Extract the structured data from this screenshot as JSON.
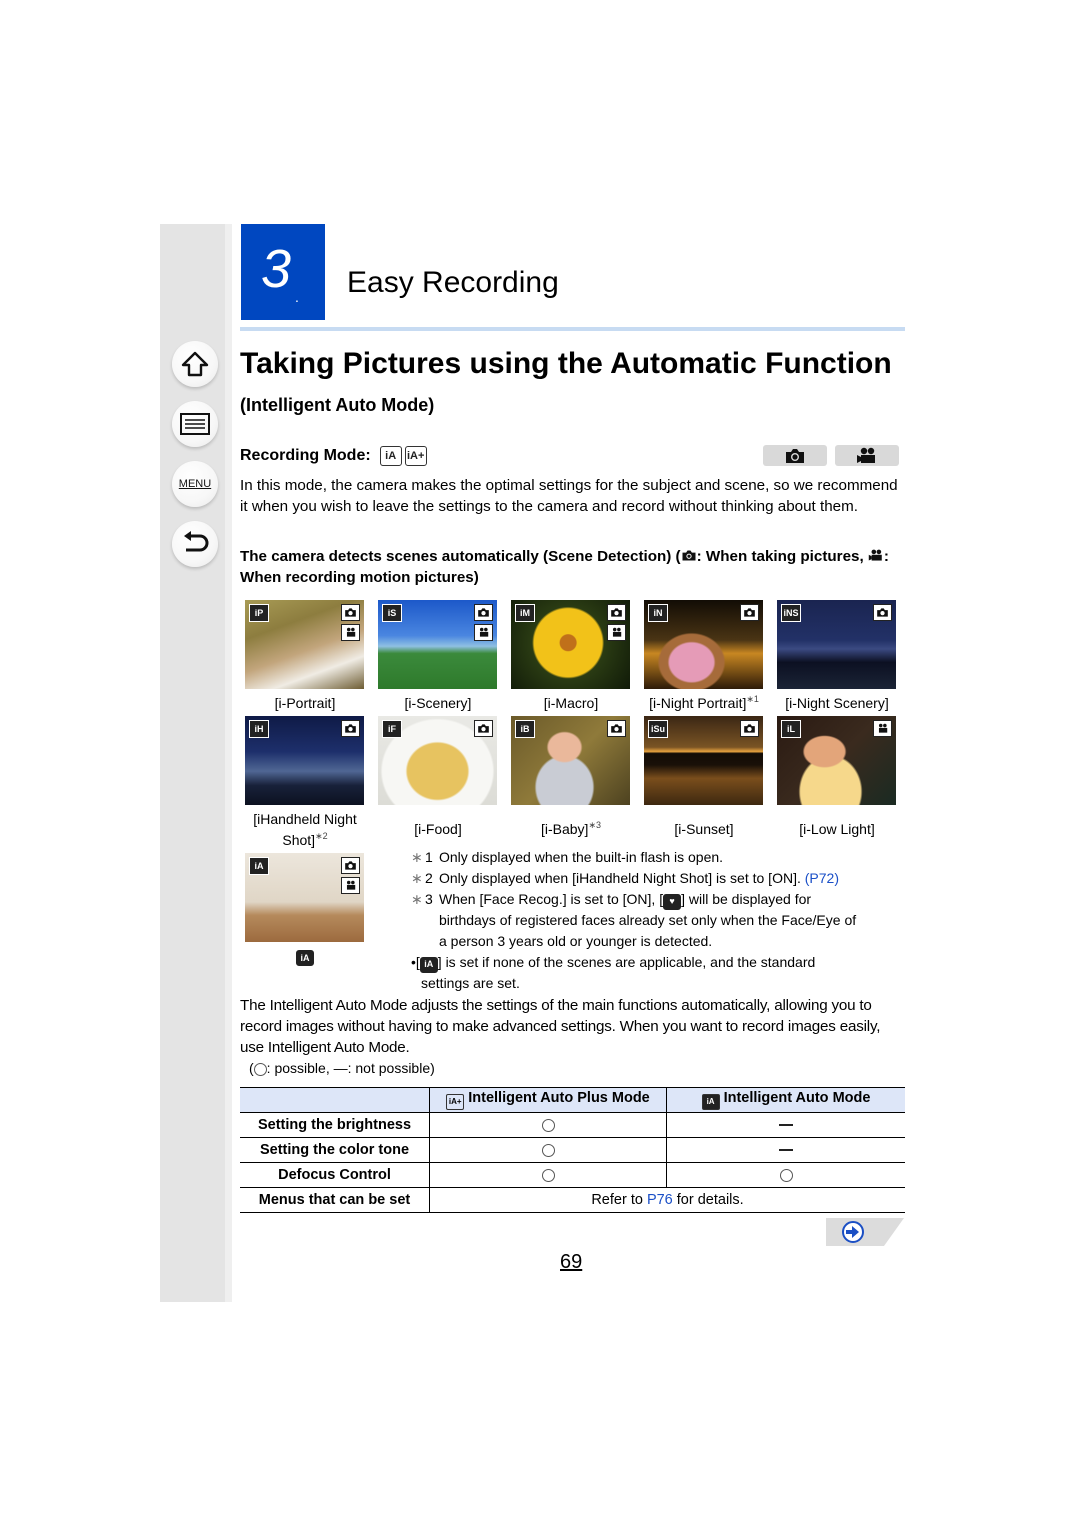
{
  "sidebar": {
    "items": [
      {
        "name": "home",
        "icon": "home-icon"
      },
      {
        "name": "contents",
        "icon": "list-icon"
      },
      {
        "name": "menu",
        "icon": "menu-icon",
        "label": "MENU"
      },
      {
        "name": "back",
        "icon": "back-arrow-icon"
      }
    ]
  },
  "chapter": {
    "number": "3",
    "dot": ".",
    "title": "Easy Recording",
    "accent_color": "#0047c0"
  },
  "page": {
    "title": "Taking Pictures using the Automatic Function",
    "subtitle": "(Intelligent Auto Mode)",
    "recording_mode_label": "Recording Mode:",
    "recording_mode_icons": [
      "iA",
      "iA+"
    ],
    "mode_tabs": [
      {
        "icon": "camera-icon"
      },
      {
        "icon": "movie-camera-icon"
      }
    ],
    "intro": "In this mode, the camera makes the optimal settings for the subject and scene, so we recommend it when you wish to leave the settings to the camera and record without thinking about them.",
    "detect_part1": "The camera detects scenes automatically (Scene Detection) (",
    "detect_part2": ": When taking pictures, ",
    "detect_part3": ": When recording motion pictures)",
    "page_number": "69"
  },
  "scenes": [
    {
      "caption": "[i-Portrait]",
      "note": "",
      "icon": "iP",
      "photo": true,
      "movie": true
    },
    {
      "caption": "[i-Scenery]",
      "note": "",
      "icon": "iS",
      "photo": true,
      "movie": true
    },
    {
      "caption": "[i-Macro]",
      "note": "",
      "icon": "iM",
      "photo": true,
      "movie": true
    },
    {
      "caption": "[i-Night Portrait]",
      "note": "∗1",
      "icon": "iN",
      "photo": true,
      "movie": false
    },
    {
      "caption": "[i-Night Scenery]",
      "note": "",
      "icon": "iNS",
      "photo": true,
      "movie": false
    },
    {
      "caption": "[iHandheld Night",
      "caption2": "Shot]",
      "note": "∗2",
      "icon": "iH",
      "photo": true,
      "movie": false
    },
    {
      "caption": "[i-Food]",
      "note": "",
      "icon": "iF",
      "photo": true,
      "movie": false
    },
    {
      "caption": "[i-Baby]",
      "note": "∗3",
      "icon": "iB",
      "photo": true,
      "movie": false
    },
    {
      "caption": "[i-Sunset]",
      "note": "",
      "icon": "iSu",
      "photo": true,
      "movie": false
    },
    {
      "caption": "[i-Low Light]",
      "note": "",
      "icon": "iL",
      "photo": false,
      "movie": true
    },
    {
      "caption": "",
      "note": "",
      "icon": "iA",
      "photo": true,
      "movie": true,
      "below_icon": "iA"
    }
  ],
  "notes": [
    {
      "mark": "∗",
      "num": "1",
      "text": "Only displayed when the built-in flash is open."
    },
    {
      "mark": "∗",
      "num": "2",
      "text": "Only displayed when [iHandheld Night Shot] is set to [ON]. ",
      "link": "(P72)"
    },
    {
      "mark": "∗",
      "num": "3",
      "text_a": "When [Face Recog.] is set to [ON], [",
      "text_b": "] will be displayed for",
      "text_c": "birthdays of registered faces already set only when the Face/Eye of",
      "text_d": "a person 3 years old or younger is detected."
    },
    {
      "bullet": "•",
      "text_a": "[",
      "text_b": "] is set if none of the scenes are applicable, and the standard",
      "text_c": "settings are set."
    }
  ],
  "summary": "The Intelligent Auto Mode adjusts the settings of the main functions automatically, allowing you to record images without having to make advanced settings. When you want to record images easily, use Intelligent Auto Mode.",
  "legend": {
    "open": "(",
    "possible": ": possible, ",
    "dash": "—",
    "not_possible": ": not possible)"
  },
  "table": {
    "headers": [
      "",
      "Intelligent Auto Plus Mode",
      "Intelligent Auto Mode"
    ],
    "header_colors": "#dde6f8",
    "rows": [
      {
        "label": "Setting the brightness",
        "plus": "possible",
        "auto": "not possible"
      },
      {
        "label": "Setting the color tone",
        "plus": "possible",
        "auto": "not possible"
      },
      {
        "label": "Defocus Control",
        "plus": "possible",
        "auto": "possible"
      },
      {
        "label": "Menus that can be set",
        "merged_a": "Refer to ",
        "merged_link": "P76",
        "merged_b": " for details."
      }
    ]
  },
  "next_page": {
    "icon": "next-arrow-icon"
  }
}
